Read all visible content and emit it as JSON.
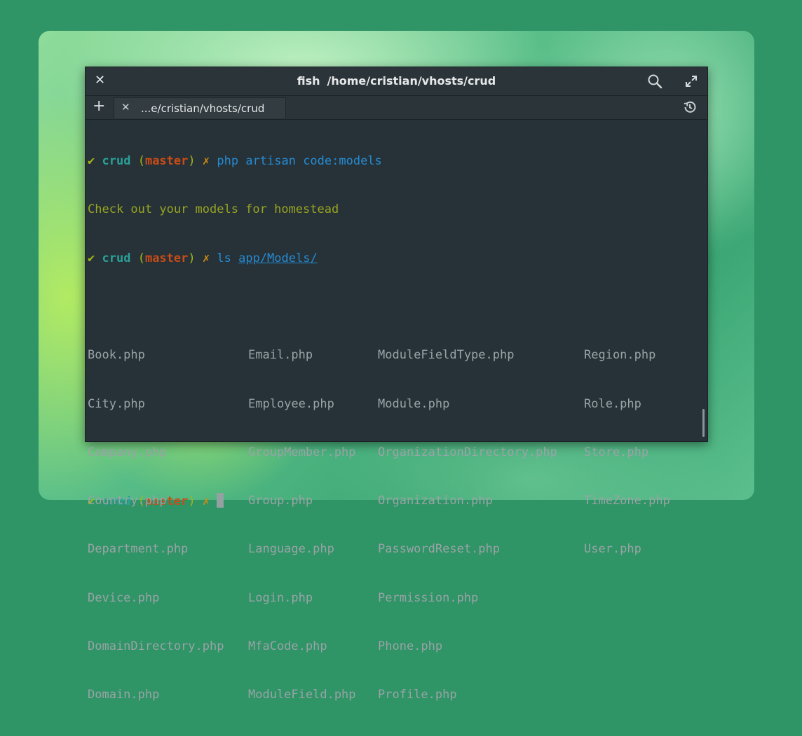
{
  "window": {
    "title_app": "fish",
    "title_path": "/home/cristian/vhosts/crud"
  },
  "tabbar": {
    "tab_label": "...e/cristian/vhosts/crud"
  },
  "prompt": {
    "check": "✔",
    "dir": "crud",
    "open_paren": "(",
    "branch": "master",
    "close_paren": ")",
    "dirty": "✗"
  },
  "command1": "php artisan code:models",
  "output1": "Check out your models for homestead",
  "command2": {
    "cmd": "ls",
    "arg": "app/Models/"
  },
  "listing": {
    "col1": [
      "Book.php",
      "City.php",
      "Company.php",
      "Country.php",
      "Department.php",
      "Device.php",
      "DomainDirectory.php",
      "Domain.php"
    ],
    "col2": [
      "Email.php",
      "Employee.php",
      "GroupMember.php",
      "Group.php",
      "Language.php",
      "Login.php",
      "MfaCode.php",
      "ModuleField.php"
    ],
    "col3": [
      "ModuleFieldType.php",
      "Module.php",
      "OrganizationDirectory.php",
      "Organization.php",
      "PasswordReset.php",
      "Permission.php",
      "Phone.php",
      "Profile.php"
    ],
    "col4": [
      "Region.php",
      "Role.php",
      "Store.php",
      "TimeZone.php",
      "User.php"
    ]
  },
  "colors": {
    "terminal_bg": "#263238",
    "prompt_check": "#a3b714",
    "prompt_dir": "#2aa198",
    "prompt_branch": "#cb4b16",
    "prompt_dirty": "#d28b12",
    "command": "#268bd2",
    "output": "#9aa520"
  },
  "icons": {
    "close": "close-icon",
    "search": "search-icon",
    "maximize": "maximize-icon",
    "new_tab": "plus-icon",
    "tab_close": "close-icon",
    "history": "history-icon"
  }
}
